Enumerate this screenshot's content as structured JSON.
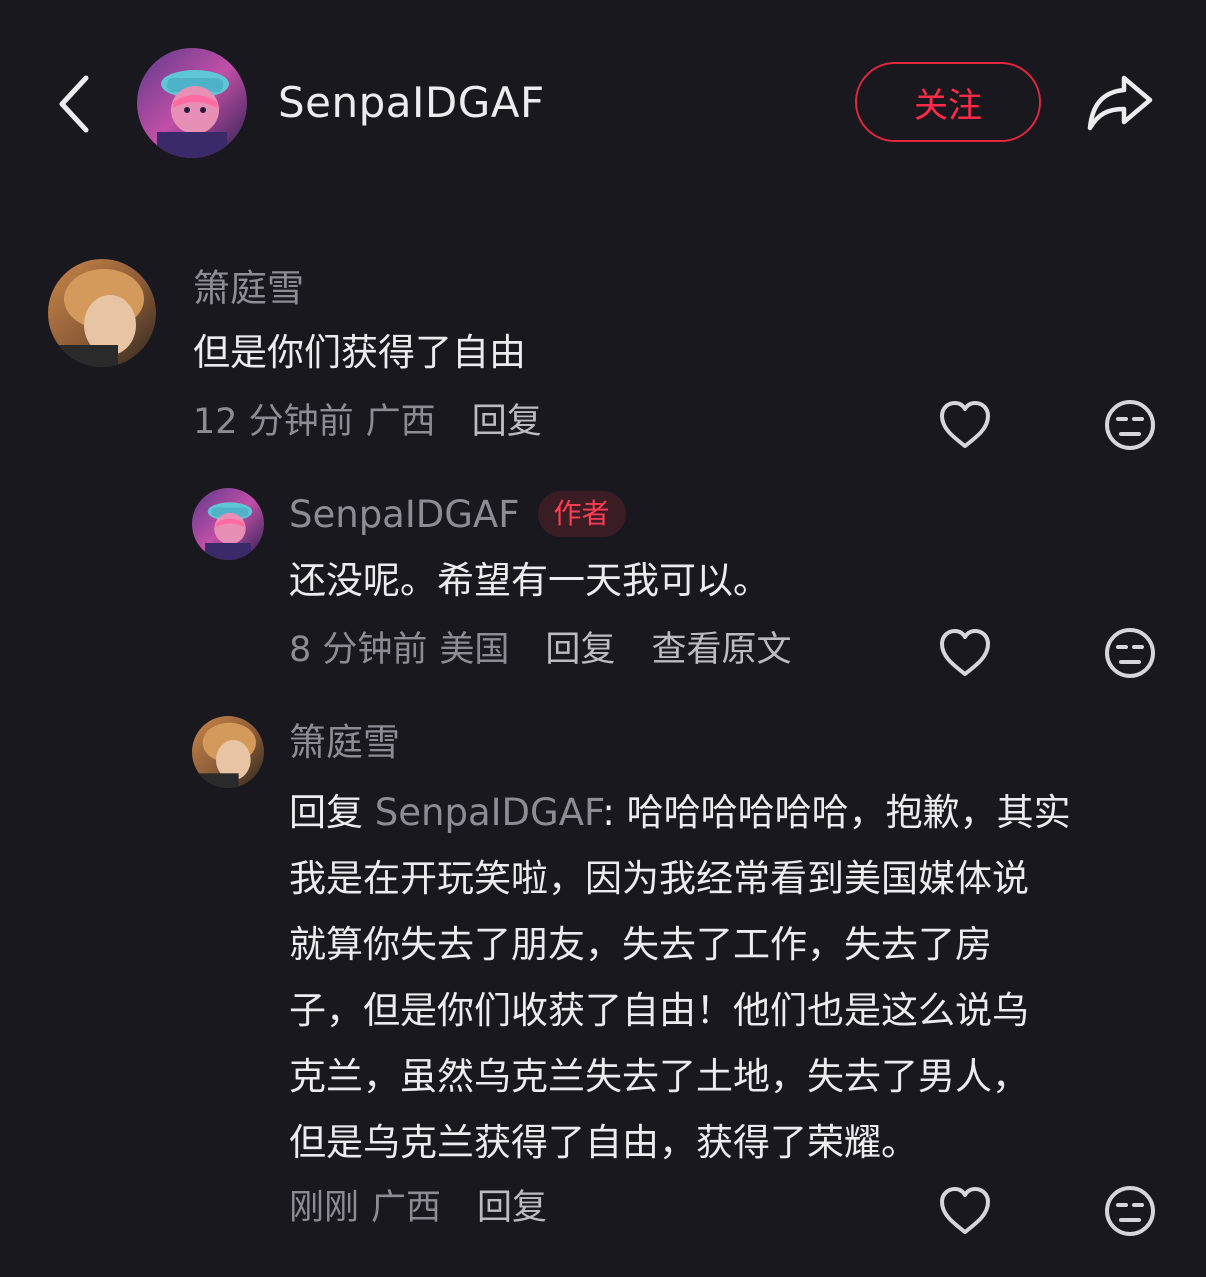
{
  "header": {
    "username": "SenpaIDGAF",
    "follow_label": "关注"
  },
  "comments": [
    {
      "author": "箫庭雪",
      "text": "但是你们获得了自由",
      "time": "12 分钟前",
      "location": "广西",
      "reply_label": "回复"
    },
    {
      "author": "SenpaIDGAF",
      "badge": "作者",
      "text": "还没呢。希望有一天我可以。",
      "time": "8 分钟前",
      "location": "美国",
      "reply_label": "回复",
      "original_label": "查看原文"
    },
    {
      "author": "箫庭雪",
      "reply_prefix": "回复",
      "reply_target": "SenpaIDGAF",
      "lines": [
        ": 哈哈哈哈哈哈，抱歉，其实",
        "我是在开玩笑啦，因为我经常看到美国媒体说",
        "就算你失去了朋友，失去了工作，失去了房",
        "子，但是你们收获了自由！他们也是这么说乌",
        "克兰，虽然乌克兰失去了土地，失去了男人，",
        "但是乌克兰获得了自由，获得了荣耀。"
      ],
      "time": "刚刚",
      "location": "广西",
      "reply_label": "回复"
    }
  ],
  "icons": {
    "back": "chevron-left-icon",
    "share": "share-arrow-icon",
    "like": "heart-outline-icon",
    "dislike": "meh-face-icon"
  },
  "colors": {
    "background": "#19181f",
    "accent": "#ff2b48",
    "text_primary": "#ecebf0",
    "text_secondary": "#8d8c94"
  }
}
